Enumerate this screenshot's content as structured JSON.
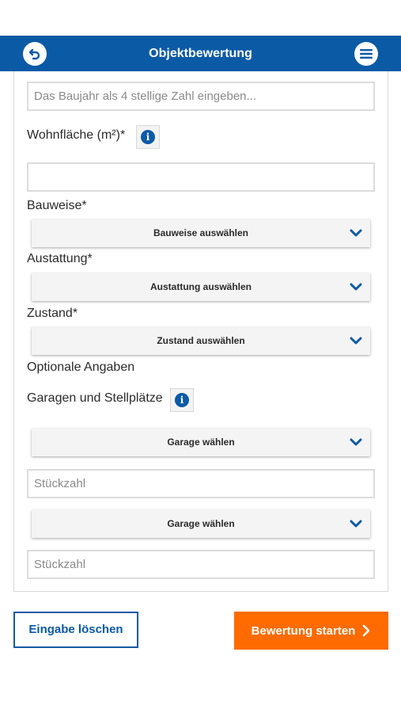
{
  "header": {
    "title": "Objektbewertung",
    "back_icon": "back-arrow-icon",
    "menu_icon": "hamburger-menu-icon",
    "color": "#0b5aa6"
  },
  "form": {
    "baujahr": {
      "placeholder": "Das Baujahr als 4 stellige Zahl eingeben...",
      "value": ""
    },
    "wohnflaeche": {
      "label": "Wohnfläche (m²)*",
      "info_icon": "info-icon",
      "value": ""
    },
    "bauweise": {
      "label": "Bauweise*",
      "selected": "Bauweise auswählen"
    },
    "ausstattung": {
      "label": "Austattung*",
      "selected": "Austattung auswählen"
    },
    "zustand": {
      "label": "Zustand*",
      "selected": "Zustand auswählen"
    },
    "optional_heading": "Optionale Angaben",
    "garagen": {
      "label": "Garagen und Stellplätze",
      "info_icon": "info-icon",
      "items": [
        {
          "selected": "Garage wählen",
          "count_placeholder": "Stückzahl"
        },
        {
          "selected": "Garage wählen",
          "count_placeholder": "Stückzahl"
        }
      ]
    }
  },
  "actions": {
    "clear_label": "Eingabe löschen",
    "start_label": "Bewertung starten",
    "start_icon": "chevron-right-icon",
    "start_color": "#ff6b00"
  }
}
